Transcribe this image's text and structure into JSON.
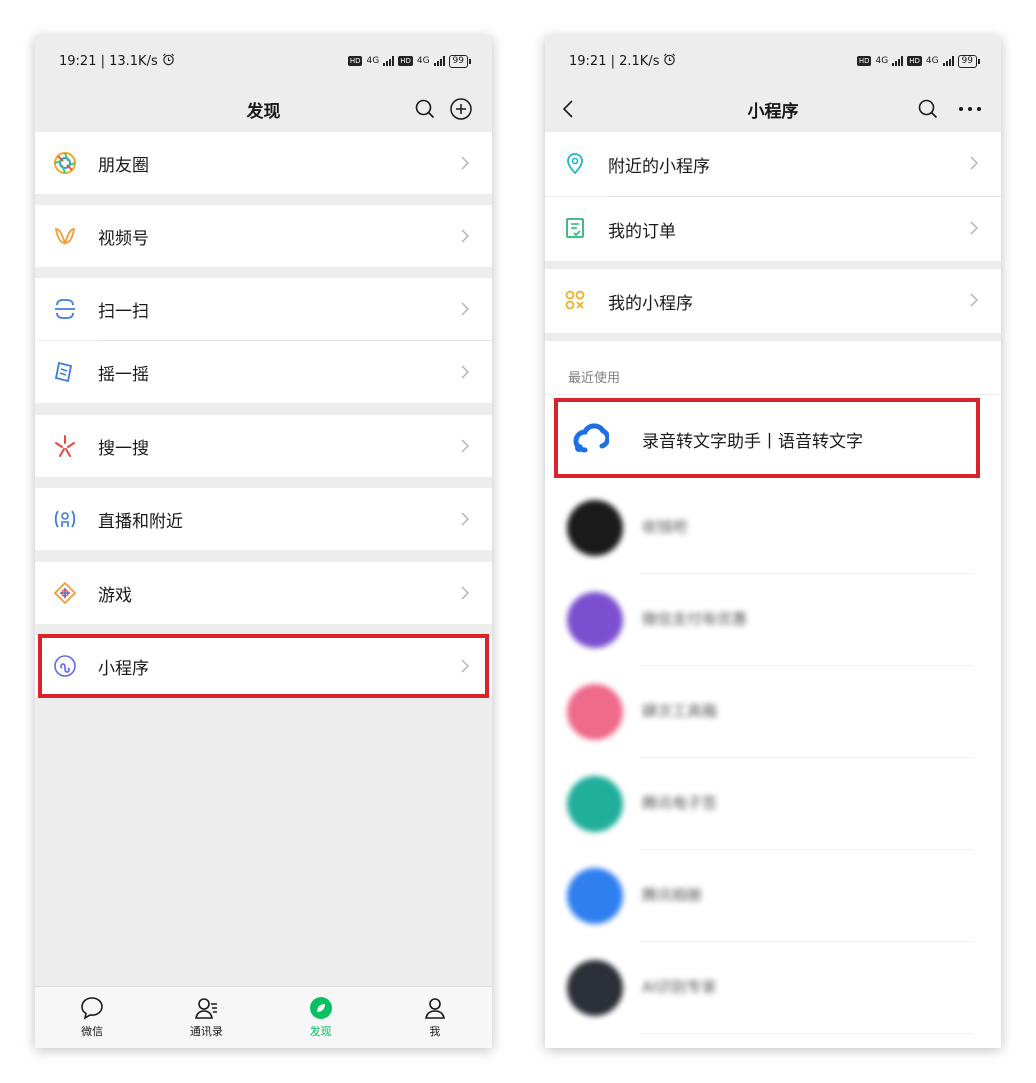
{
  "left": {
    "status": {
      "time": "19:21 | 13.1K/s",
      "net": "4G",
      "net2": "4G",
      "battery": "99"
    },
    "title": "发现",
    "items": [
      {
        "label": "朋友圈",
        "icon": "moments-icon"
      },
      {
        "label": "视频号",
        "icon": "channels-icon"
      },
      {
        "label": "扫一扫",
        "icon": "scan-icon"
      },
      {
        "label": "摇一摇",
        "icon": "shake-icon"
      },
      {
        "label": "搜一搜",
        "icon": "search-feature-icon"
      },
      {
        "label": "直播和附近",
        "icon": "live-nearby-icon"
      },
      {
        "label": "游戏",
        "icon": "games-icon"
      },
      {
        "label": "小程序",
        "icon": "miniprogram-icon"
      }
    ],
    "tabs": [
      {
        "label": "微信",
        "icon": "chat-bubble-icon"
      },
      {
        "label": "通讯录",
        "icon": "contacts-icon"
      },
      {
        "label": "发现",
        "icon": "discover-compass-icon",
        "active": true
      },
      {
        "label": "我",
        "icon": "me-person-icon"
      }
    ]
  },
  "right": {
    "status": {
      "time": "19:21 | 2.1K/s",
      "net": "4G",
      "net2": "4G",
      "battery": "99"
    },
    "title": "小程序",
    "items": [
      {
        "label": "附近的小程序",
        "icon": "location-pin-icon"
      },
      {
        "label": "我的订单",
        "icon": "order-list-icon"
      },
      {
        "label": "我的小程序",
        "icon": "my-miniprogram-icon"
      }
    ],
    "recent_label": "最近使用",
    "featured": {
      "label": "录音转文字助手丨语音转文字",
      "icon": "cloud-transcribe-icon"
    },
    "apps": [
      {
        "name": "收钱吧",
        "color": "#1a1a1a"
      },
      {
        "name": "微信支付有优惠",
        "color": "#7b4fd0"
      },
      {
        "name": "肆次工具箱",
        "color": "#f06a8a"
      },
      {
        "name": "腾讯电子签",
        "color": "#1fae9a"
      },
      {
        "name": "腾讯相册",
        "color": "#2f7ff0"
      },
      {
        "name": "AI识别专家",
        "color": "#2a2f38"
      }
    ]
  },
  "colors": {
    "accent": "#07c160",
    "highlight": "#d9232a",
    "page_bg": "#ededed"
  }
}
